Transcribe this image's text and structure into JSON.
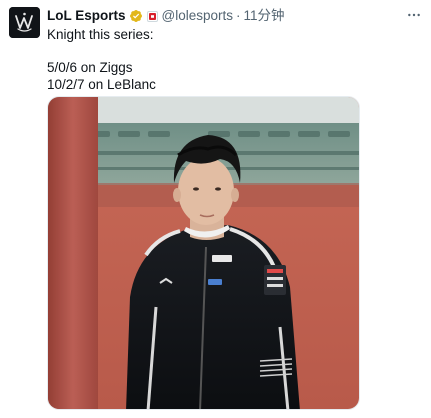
{
  "tweet": {
    "display_name": "LoL Esports",
    "handle": "@lolesports",
    "separator": "·",
    "time": "11分钟",
    "lines": [
      "Knight this series:",
      "",
      "5/0/6 on Ziggs",
      "10/2/7 on LeBlanc"
    ]
  },
  "icons": {
    "avatar": "lol-esports-logo",
    "verified": "gold-verified-badge-icon",
    "affiliation": "affiliate-flag-icon",
    "more": "more-icon"
  },
  "colors": {
    "verified_gold": "#e2b719",
    "affiliate_red": "#d8202d",
    "secondary_text": "#536471"
  }
}
